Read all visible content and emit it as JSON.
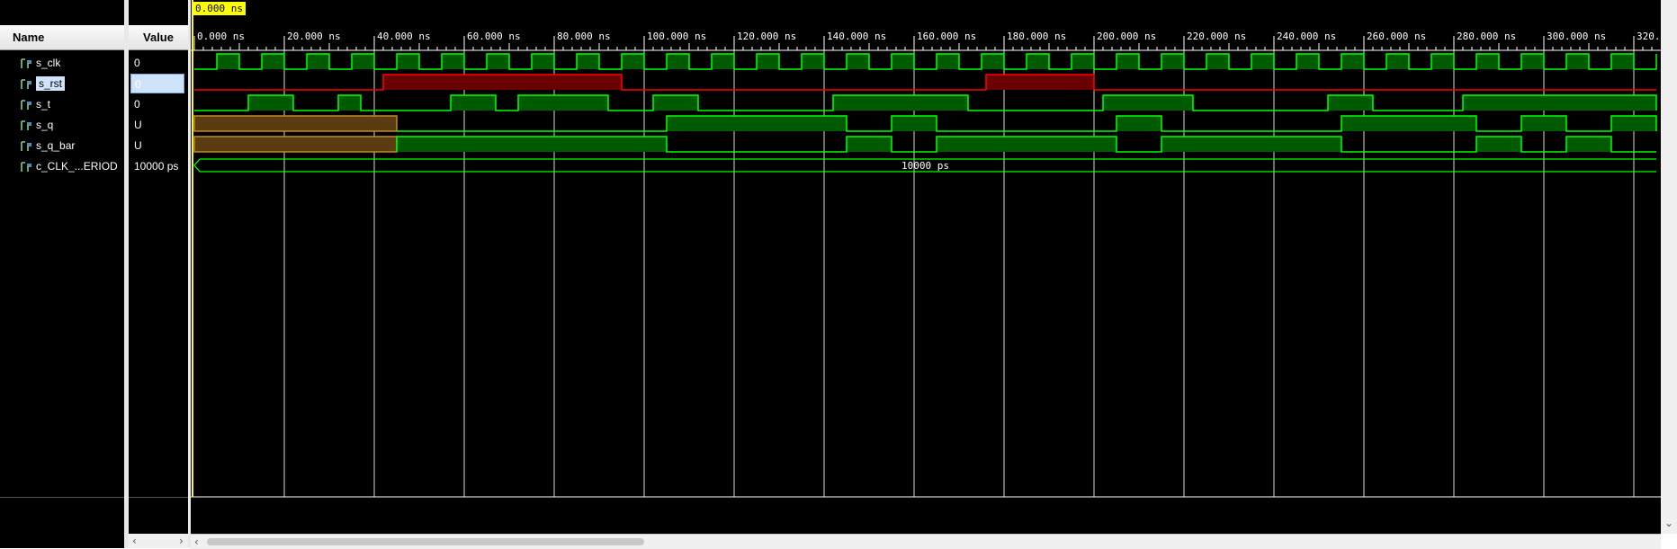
{
  "header": {
    "name_col": "Name",
    "value_col": "Value"
  },
  "cursor": {
    "label": "0.000 ns"
  },
  "timeline": {
    "unit": "ns",
    "ticks": [
      "0.000 ns",
      "20.000 ns",
      "40.000 ns",
      "60.000 ns",
      "80.000 ns",
      "100.000 ns",
      "120.000 ns",
      "140.000 ns",
      "160.000 ns",
      "180.000 ns",
      "200.000 ns",
      "220.000 ns",
      "240.000 ns",
      "260.000 ns",
      "280.000 ns",
      "300.000 ns",
      "320."
    ],
    "range_ns": [
      0,
      325
    ]
  },
  "signals": [
    {
      "name": "s_clk",
      "value": "0",
      "icon": "signal-icon",
      "selected": false
    },
    {
      "name": "s_rst",
      "value": "0",
      "icon": "signal-icon",
      "selected": true
    },
    {
      "name": "s_t",
      "value": "0",
      "icon": "signal-icon",
      "selected": false
    },
    {
      "name": "s_q",
      "value": "U",
      "icon": "signal-icon",
      "selected": false
    },
    {
      "name": "s_q_bar",
      "value": "U",
      "icon": "signal-icon",
      "selected": false
    },
    {
      "name": "c_CLK_...ERIOD",
      "value": "10000 ps",
      "icon": "constant-icon",
      "selected": false
    }
  ],
  "waveforms": {
    "s_clk": {
      "type": "clock",
      "period_ns": 10,
      "start_low": true
    },
    "s_rst": {
      "type": "bit",
      "color": "#ff0000",
      "high_intervals_ns": [
        [
          42,
          95
        ],
        [
          176,
          200
        ]
      ]
    },
    "s_t": {
      "type": "bit",
      "color": "#00ff00",
      "high_intervals_ns": [
        [
          12,
          22
        ],
        [
          32,
          37
        ],
        [
          57,
          67
        ],
        [
          72,
          92
        ],
        [
          102,
          112
        ],
        [
          142,
          172
        ],
        [
          202,
          222
        ],
        [
          252,
          262
        ],
        [
          282,
          325
        ]
      ]
    },
    "s_q": {
      "type": "bit",
      "color": "#00ff00",
      "undefined_until_ns": 45,
      "high_intervals_ns": [
        [
          105,
          145
        ],
        [
          155,
          165
        ],
        [
          205,
          215
        ],
        [
          255,
          285
        ],
        [
          295,
          305
        ],
        [
          315,
          325
        ]
      ]
    },
    "s_q_bar": {
      "type": "bit",
      "color": "#00ff00",
      "undefined_until_ns": 45,
      "high_intervals_ns": [
        [
          45,
          105
        ],
        [
          145,
          155
        ],
        [
          165,
          205
        ],
        [
          215,
          255
        ],
        [
          285,
          295
        ],
        [
          305,
          315
        ]
      ]
    },
    "c_CLK_...ERIOD": {
      "type": "bus",
      "label": "10000 ps"
    }
  },
  "colors": {
    "background": "#000000",
    "wave": "#00ff00",
    "reset": "#ff0000",
    "undefined": "#c08a2a",
    "grid": "#ffffff",
    "cursor": "#ffff00"
  }
}
